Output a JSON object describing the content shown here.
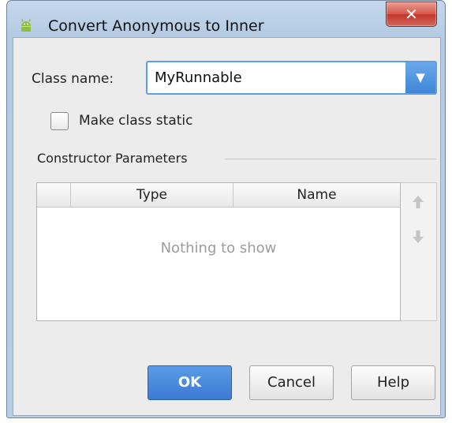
{
  "window": {
    "title": "Convert Anonymous to Inner",
    "close_glyph": "✕",
    "app_icon": "android-icon"
  },
  "form": {
    "class_name_label": "Class name:",
    "class_name_value": "MyRunnable",
    "dropdown_glyph": "▼",
    "make_static_label": "Make class static",
    "make_static_checked": false
  },
  "constructor_parameters": {
    "section_label": "Constructor Parameters",
    "columns": [
      "",
      "Type",
      "Name"
    ],
    "rows": [],
    "empty_text": "Nothing to show",
    "move_up_icon": "arrow-up-icon",
    "move_down_icon": "arrow-down-icon"
  },
  "buttons": {
    "ok": "OK",
    "cancel": "Cancel",
    "help": "Help"
  },
  "colors": {
    "accent": "#3f86d8",
    "close": "#c2352a"
  }
}
